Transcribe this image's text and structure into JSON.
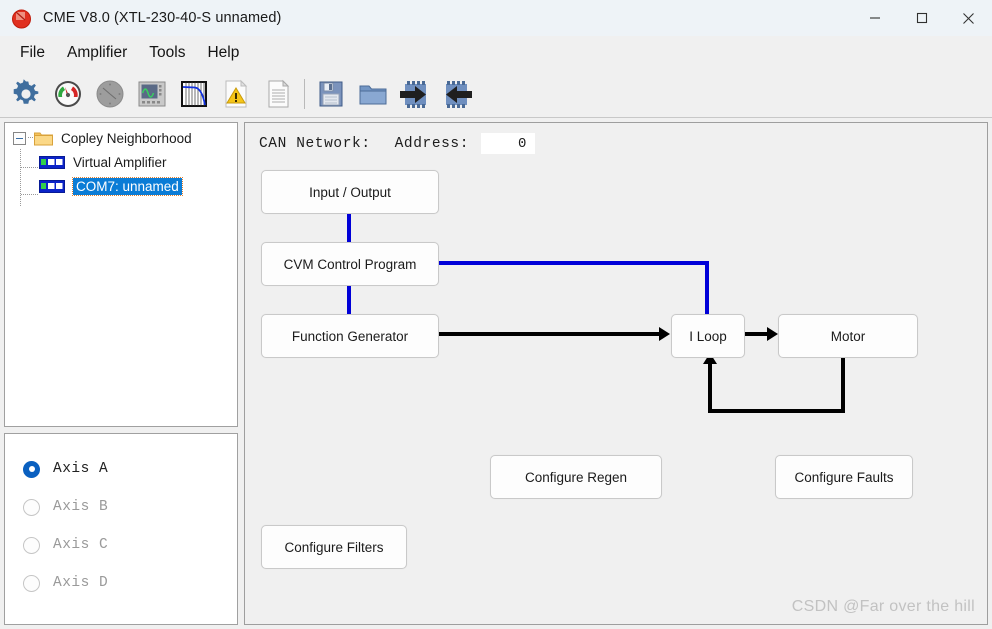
{
  "window": {
    "title": "CME V8.0 (XTL-230-40-S unnamed)",
    "app_icon": "copley-logo-icon",
    "controls": [
      {
        "name": "minimize-button",
        "glyph": "─"
      },
      {
        "name": "maximize-button",
        "glyph": "□"
      },
      {
        "name": "close-button",
        "glyph": "✕"
      }
    ]
  },
  "menubar": {
    "items": [
      "File",
      "Amplifier",
      "Tools",
      "Help"
    ]
  },
  "toolbar": {
    "items": [
      {
        "name": "basic-setup-icon",
        "tip": "Basic Setup"
      },
      {
        "name": "control-panel-icon",
        "tip": "Control Panel"
      },
      {
        "name": "manual-phase-icon",
        "tip": "Manual Phase"
      },
      {
        "name": "scope-icon",
        "tip": "Scope"
      },
      {
        "name": "filter-plot-icon",
        "tip": "Filter"
      },
      {
        "name": "error-log-icon",
        "tip": "Error Log"
      },
      {
        "name": "data-file-icon",
        "tip": "Data File"
      },
      {
        "name": "separator",
        "tip": ""
      },
      {
        "name": "save-icon",
        "tip": "Save"
      },
      {
        "name": "open-folder-icon",
        "tip": "Open"
      },
      {
        "name": "download-to-amp-icon",
        "tip": "Download to Amplifier"
      },
      {
        "name": "upload-from-amp-icon",
        "tip": "Upload from Amplifier"
      }
    ]
  },
  "tree": {
    "root": {
      "label": "Copley Neighborhood",
      "icon": "folder-icon",
      "expanded": true
    },
    "children": [
      {
        "label": "Virtual Amplifier",
        "icon": "amplifier-icon",
        "selected": false
      },
      {
        "label": "COM7: unnamed",
        "icon": "amplifier-icon",
        "selected": true
      }
    ]
  },
  "axis_panel": {
    "options": [
      {
        "label": "Axis A",
        "selected": true,
        "enabled": true
      },
      {
        "label": "Axis B",
        "selected": false,
        "enabled": false
      },
      {
        "label": "Axis C",
        "selected": false,
        "enabled": false
      },
      {
        "label": "Axis D",
        "selected": false,
        "enabled": false
      }
    ]
  },
  "main": {
    "network_label": "CAN Network:",
    "address_label": "Address:",
    "address_value": "0",
    "blocks": [
      {
        "name": "input-output-block",
        "label": "Input / Output"
      },
      {
        "name": "cvm-control-program-block",
        "label": "CVM Control Program"
      },
      {
        "name": "function-generator-block",
        "label": "Function Generator"
      },
      {
        "name": "i-loop-block",
        "label": "I Loop"
      },
      {
        "name": "motor-block",
        "label": "Motor"
      }
    ],
    "buttons": [
      {
        "name": "configure-regen-button",
        "label": "Configure Regen"
      },
      {
        "name": "configure-faults-button",
        "label": "Configure Faults"
      },
      {
        "name": "configure-filters-button",
        "label": "Configure Filters"
      }
    ],
    "watermark": "CSDN @Far over the hill"
  },
  "colors": {
    "titlebar": "#eef3f7",
    "chrome": "#f0f0f0",
    "wire_blue": "#0000d8",
    "wire_black": "#000000",
    "selection": "#0a7cd6",
    "accent_radio": "#0a60c0"
  }
}
